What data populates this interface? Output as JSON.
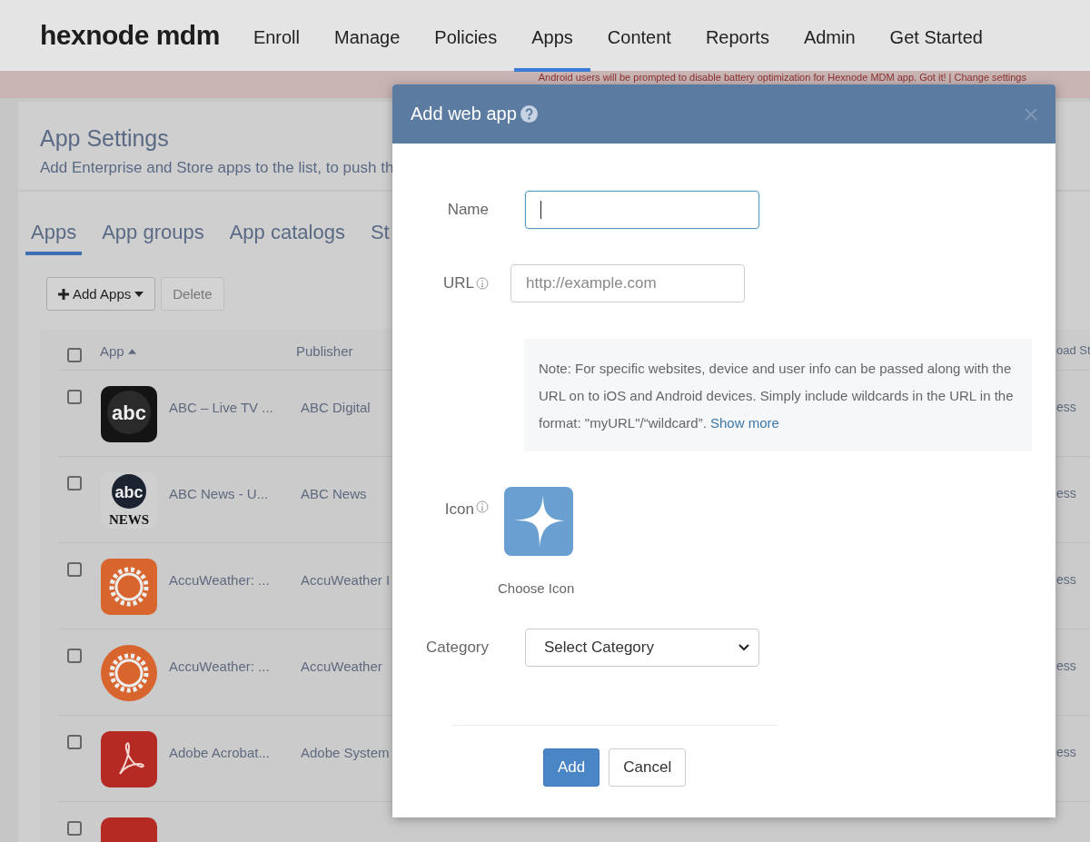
{
  "nav": {
    "logo": "hexnode mdm",
    "items": [
      {
        "label": "Enroll",
        "selected": false
      },
      {
        "label": "Manage",
        "selected": false
      },
      {
        "label": "Policies",
        "selected": false
      },
      {
        "label": "Apps",
        "selected": true
      },
      {
        "label": "Content",
        "selected": false
      },
      {
        "label": "Reports",
        "selected": false
      },
      {
        "label": "Admin",
        "selected": false
      },
      {
        "label": "Get Started",
        "selected": false
      }
    ]
  },
  "banner": {
    "text": "Android users will be prompted to disable battery optimization for Hexnode MDM app. Got it! | Change settings"
  },
  "page": {
    "title": "App Settings",
    "subtitle": "Add Enterprise and Store apps to the list, to push th",
    "tabs": [
      {
        "label": "Apps",
        "selected": true
      },
      {
        "label": "App groups",
        "selected": false
      },
      {
        "label": "App catalogs",
        "selected": false
      },
      {
        "label": "St",
        "selected": false
      }
    ],
    "toolbar": {
      "add": "Add Apps",
      "delete": "Delete"
    }
  },
  "table": {
    "columns": [
      "App",
      "Publisher",
      "oad St"
    ],
    "header_checked": false,
    "partial_row": {
      "checked": false
    },
    "rows": [
      {
        "kind": "abc",
        "logo_text": [
          "abc"
        ],
        "name": "ABC – Live TV ...",
        "publisher": "ABC Digital",
        "status": "ess",
        "checked": false
      },
      {
        "kind": "abc-news",
        "logo_text": [
          "abc",
          "NEWS"
        ],
        "name": "ABC News - U...",
        "publisher": "ABC News",
        "status": "ess",
        "checked": false
      },
      {
        "kind": "sun-square",
        "name": "AccuWeather: ...",
        "publisher": "AccuWeather I",
        "status": "ess",
        "checked": false
      },
      {
        "kind": "sun-round",
        "name": "AccuWeather: ...",
        "publisher": "AccuWeather",
        "status": "ess",
        "checked": false
      },
      {
        "kind": "acrobat",
        "name": "Adobe Acrobat...",
        "publisher": "Adobe System",
        "status": "ess",
        "checked": false
      }
    ]
  },
  "dialog": {
    "title": "Add web app",
    "name": {
      "label": "Name",
      "focused": true
    },
    "url": {
      "label": "URL",
      "placeholder": "http://example.com"
    },
    "note": {
      "text": "Note: For specific websites, device and user info can be passed along with the URL on to iOS and Android devices. Simply include wildcards in the URL in the format: \"myURL\"/“wildcard”.",
      "link": "Show more"
    },
    "icon": {
      "label": "Icon",
      "caption": "Choose Icon"
    },
    "category": {
      "label": "Category",
      "value": "Select Category"
    },
    "buttons": {
      "add": "Add",
      "cancel": "Cancel"
    }
  }
}
